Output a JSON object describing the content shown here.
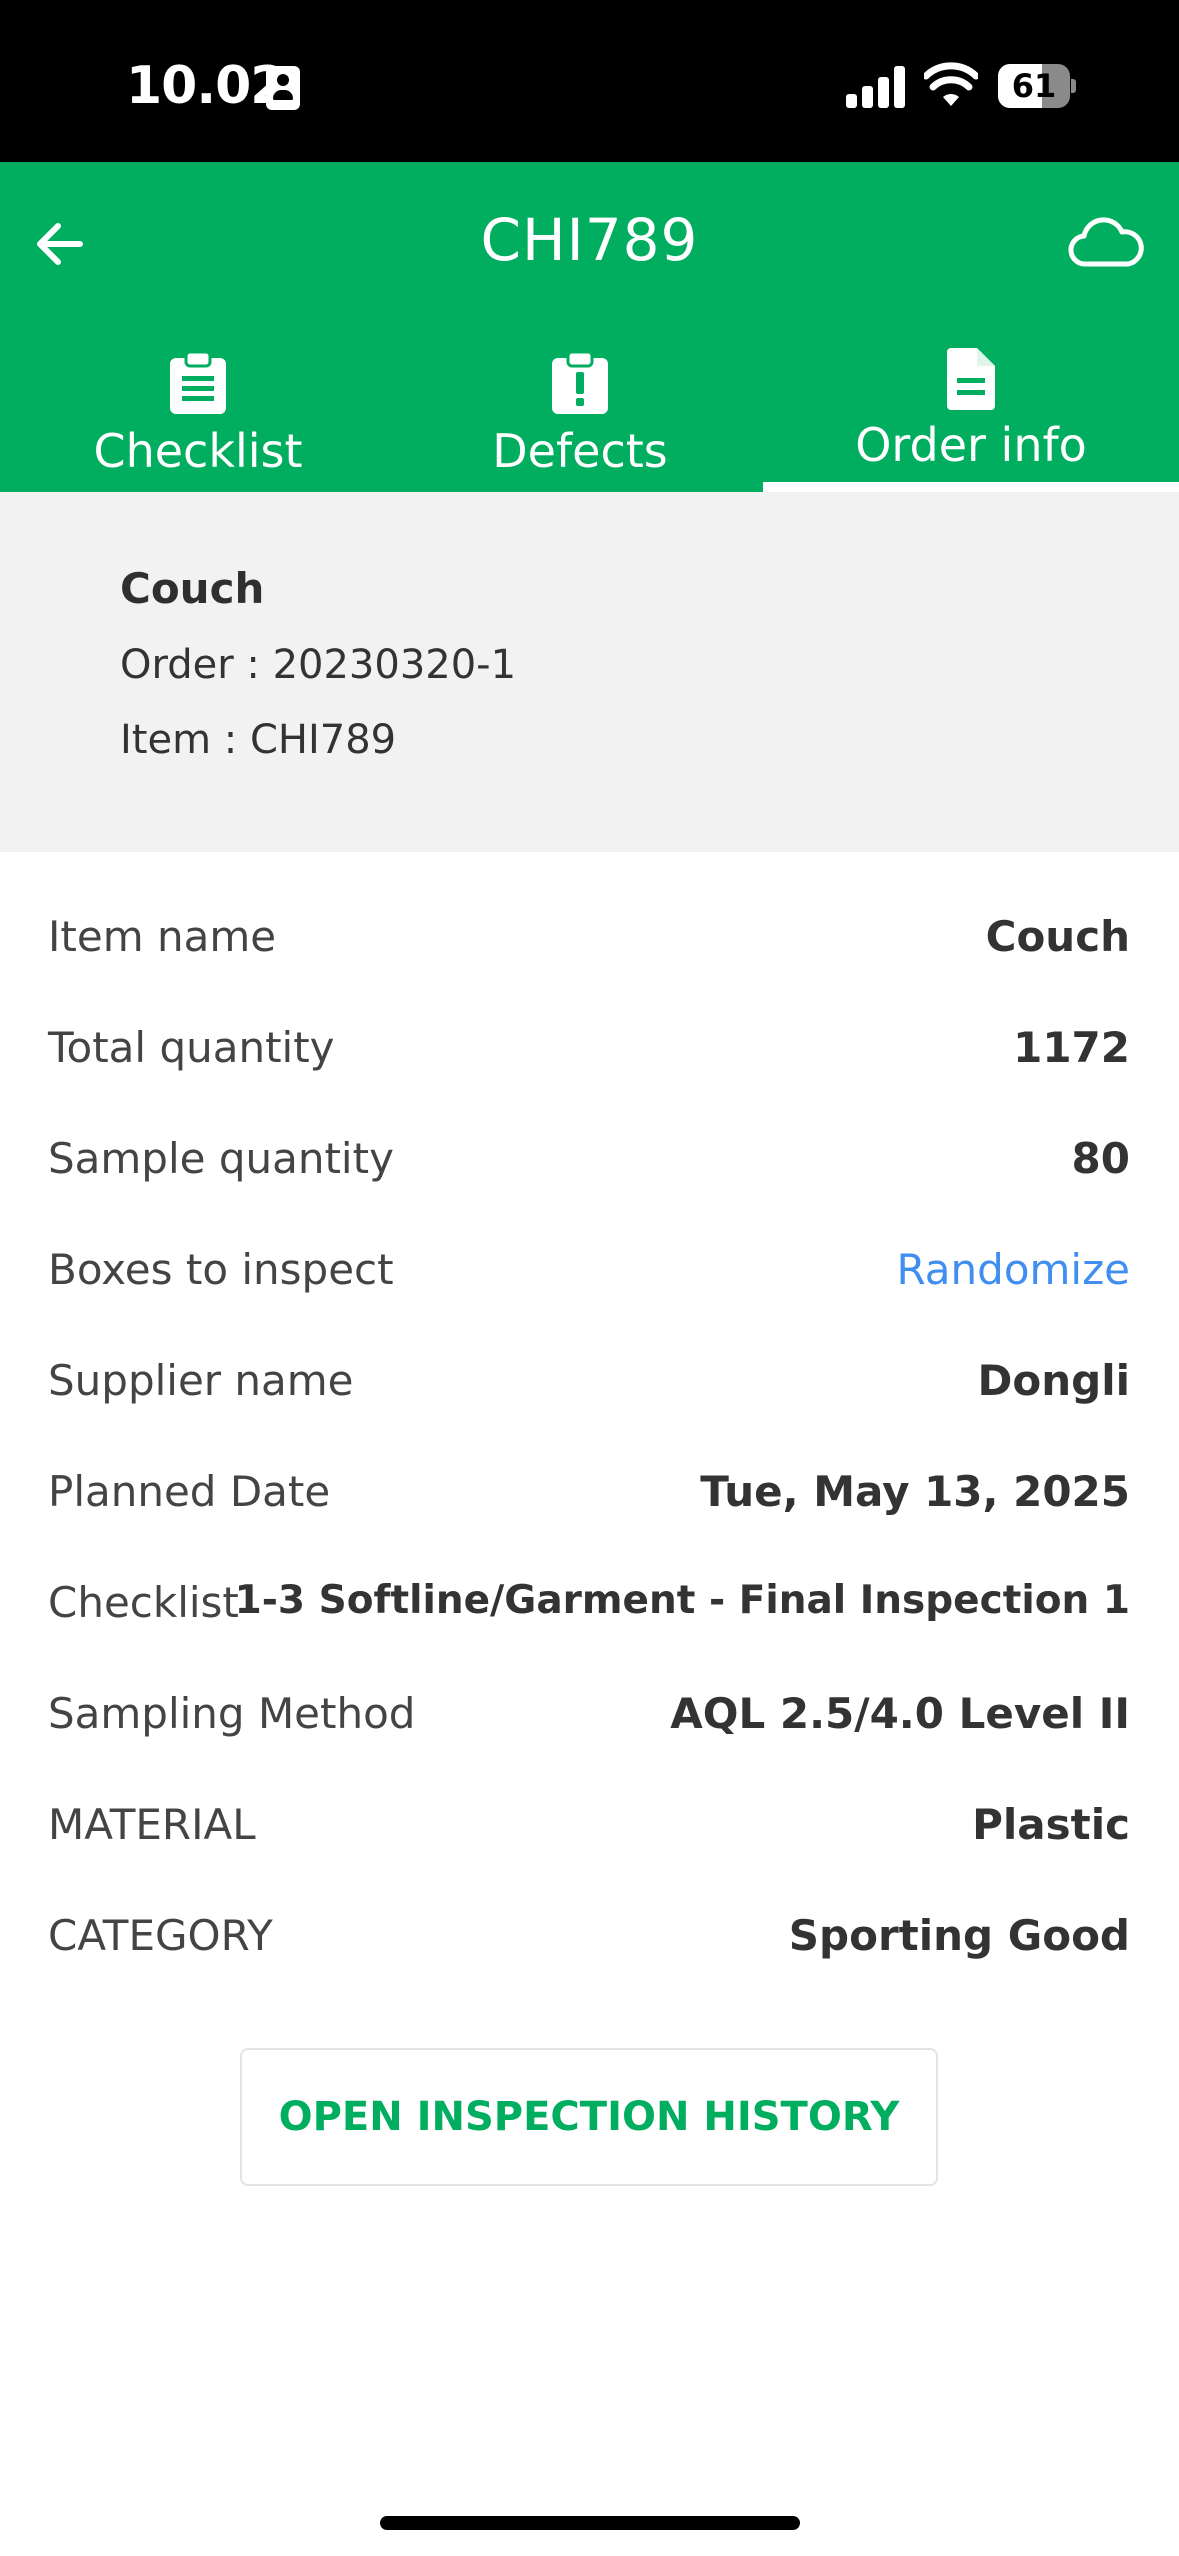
{
  "status_bar": {
    "time": "10.02",
    "battery": "61",
    "battery_level": 0.61,
    "icons": [
      "sim-card-icon",
      "cellular-signal-icon",
      "wifi-icon",
      "battery-icon"
    ]
  },
  "header": {
    "title": "CHI789",
    "back_icon": "arrow-left-icon",
    "cloud_icon": "cloud-icon",
    "background_color": "#01ad5f"
  },
  "tabs": [
    {
      "label": "Checklist",
      "icon": "clipboard-list-icon",
      "active": false
    },
    {
      "label": "Defects",
      "icon": "clipboard-alert-icon",
      "active": false
    },
    {
      "label": "Order info",
      "icon": "document-icon",
      "active": true
    }
  ],
  "summary": {
    "name": "Couch",
    "order": "Order : 20230320-1",
    "item": "Item : CHI789"
  },
  "details": [
    {
      "label": "Item name",
      "value": "Couch"
    },
    {
      "label": "Total quantity",
      "value": "1172"
    },
    {
      "label": "Sample quantity",
      "value": "80"
    },
    {
      "label": "Boxes to inspect",
      "value": "Randomize",
      "link": true
    },
    {
      "label": "Supplier name",
      "value": "Dongli"
    },
    {
      "label": "Planned Date",
      "value": "Tue, May 13, 2025"
    },
    {
      "label": "Checklist",
      "value": "1-3 Softline/Garment - Final Inspection 1"
    },
    {
      "label": "Sampling Method",
      "value": "AQL 2.5/4.0 Level II"
    },
    {
      "label": "MATERIAL",
      "value": "Plastic"
    },
    {
      "label": "CATEGORY",
      "value": "Sporting Good"
    }
  ],
  "history_button": {
    "label": "OPEN INSPECTION HISTORY",
    "color": "#01ad5f"
  },
  "link_color": "#3f8ef0"
}
